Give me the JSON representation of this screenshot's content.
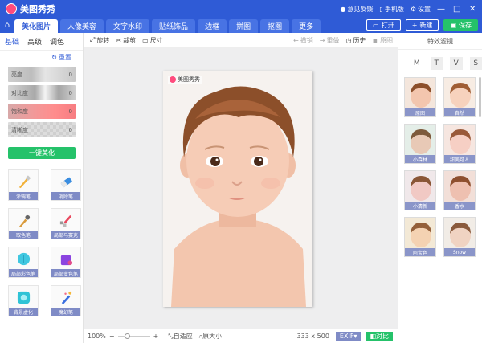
{
  "app": {
    "title": "美图秀秀"
  },
  "titlebar": {
    "feedback": "意见反馈",
    "mobile": "手机版",
    "settings": "设置",
    "minimize": "—",
    "maximize": "□",
    "close": "✕"
  },
  "tabs": [
    {
      "label": "美化图片",
      "active": true
    },
    {
      "label": "人像美容"
    },
    {
      "label": "文字水印"
    },
    {
      "label": "贴纸饰品"
    },
    {
      "label": "边框"
    },
    {
      "label": "拼图"
    },
    {
      "label": "抠图"
    },
    {
      "label": "更多"
    }
  ],
  "tab_actions": {
    "open": "打开",
    "new": "新建",
    "save": "保存"
  },
  "left": {
    "subtabs": [
      "基础",
      "高级",
      "调色"
    ],
    "reset": "重置",
    "sliders": [
      {
        "label": "亮度",
        "value": "0"
      },
      {
        "label": "对比度",
        "value": "0"
      },
      {
        "label": "饱和度",
        "value": "0"
      },
      {
        "label": "清晰度",
        "value": "0"
      }
    ],
    "one_key": "一键美化",
    "tools": [
      "涂鸦笔",
      "消除笔",
      "取色笔",
      "局部马赛克",
      "局部彩色笔",
      "局部变色笔",
      "背景虚化",
      "魔幻笔"
    ]
  },
  "toolbar": {
    "rotate": "旋转",
    "crop": "裁剪",
    "size": "尺寸",
    "undo": "撤销",
    "redo": "重做",
    "history": "历史",
    "original": "原图"
  },
  "photo": {
    "watermark": "美图秀秀"
  },
  "status": {
    "zoom": "100%",
    "minus": "−",
    "plus": "+",
    "fit": "自适应",
    "actual": "原大小",
    "dims": "333 x 500",
    "exif": "EXIF",
    "compare": "对比"
  },
  "right": {
    "title": "特效滤镜",
    "categories": [
      "M",
      "T",
      "V",
      "S"
    ],
    "filters": [
      "原图",
      "自然",
      "小森林",
      "甜美可人",
      "小清新",
      "香水",
      "阿宝色",
      "Snow"
    ]
  },
  "colors": {
    "brand": "#2f5bd6",
    "accent": "#25c26a",
    "tool_label": "#7f8bc6"
  }
}
